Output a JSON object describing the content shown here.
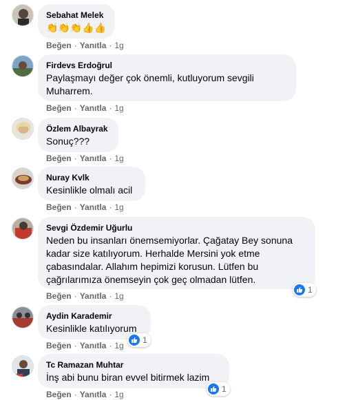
{
  "action_labels": {
    "like": "Beğen",
    "reply": "Yanıtla"
  },
  "separator": "·",
  "comments": [
    {
      "author": "Sebahat Melek",
      "text": "👏👏👏👍👍",
      "age": "1g",
      "reactions": ""
    },
    {
      "author": "Firdevs Erdoğrul",
      "text_lines": [
        "Paylaşmayı değer çok önemli, kutluyorum sevgili",
        "Muharrem."
      ],
      "age": "1g",
      "reactions": ""
    },
    {
      "author": "Özlem Albayrak",
      "text": "Sonuç???",
      "age": "1g",
      "reactions": ""
    },
    {
      "author": "Nuray Kvlk",
      "text": "Kesinlikle olmalı acil",
      "age": "1g",
      "reactions": ""
    },
    {
      "author": "Sevgi Özdemir Uğurlu",
      "text_lines": [
        "Neden bu insanları önemsemiyorlar. Çağatay Bey sonuna",
        "kadar size katılıyorum. Herhalde Mersini yok etme",
        "çabasındalar. Allahım hepimizi korusun. Lütfen bu",
        "çağrılarımıza önemseyin çok geç olmadan lütfen."
      ],
      "age": "1g",
      "reactions": "1"
    },
    {
      "author": "Aydin Karademir",
      "text": "Kesinlikle katılıyorum",
      "age": "1g",
      "reactions": "1"
    },
    {
      "author": "Tc Ramazan Muhtar",
      "text": "İnş abi bunu biran evvel bitirmek lazim",
      "age": "1g",
      "reactions": "1"
    }
  ]
}
